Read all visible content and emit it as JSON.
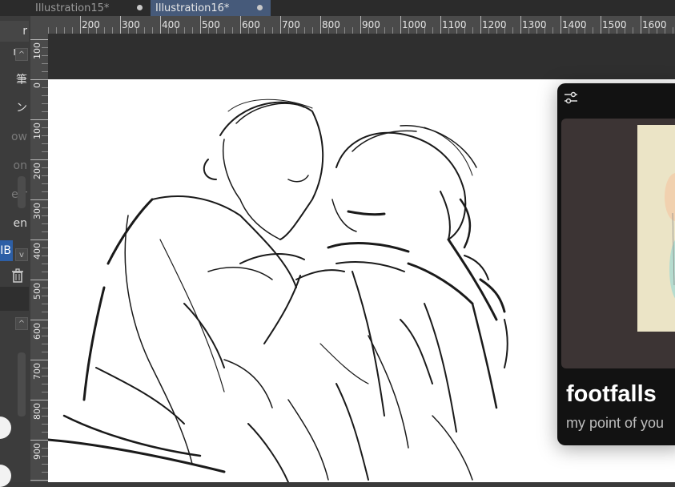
{
  "tabs": [
    {
      "label": "Illustration15*"
    },
    {
      "label": "Illustration16*"
    }
  ],
  "left_panel": {
    "items": [
      {
        "label": "r"
      },
      {
        "label": "ng"
      },
      {
        "label": "筆"
      },
      {
        "label": "ン"
      },
      {
        "label": "ow"
      },
      {
        "label": "on"
      },
      {
        "label": "err"
      },
      {
        "label": "en"
      },
      {
        "label": "IB"
      }
    ],
    "scroll_up": "^",
    "scroll_down": "v",
    "trash_icon": "trash-icon"
  },
  "ruler": {
    "h_labels": [
      "200",
      "300",
      "400",
      "500",
      "600",
      "700",
      "800",
      "900",
      "1000",
      "1100",
      "1200",
      "1300",
      "1400",
      "1500",
      "1600"
    ],
    "v_labels": [
      "100",
      "0",
      "100",
      "200",
      "300",
      "400",
      "500",
      "600",
      "700",
      "800",
      "900"
    ]
  },
  "player_card": {
    "settings_icon": "sliders-icon",
    "title": "footfalls",
    "subtitle": "my point of you"
  },
  "colors": {
    "active_tab": "#465a7a",
    "selected_item": "#2d5fa6",
    "card_bg": "#121212"
  }
}
